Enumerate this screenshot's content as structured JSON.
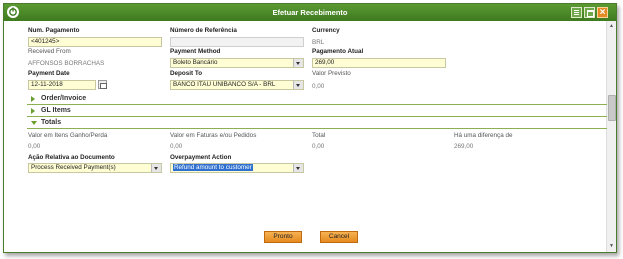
{
  "window": {
    "title": "Efetuar Recebimento",
    "accent": "#4a8a28",
    "icons": [
      "app-logo-icon",
      "menu-icon",
      "maximize-icon",
      "close-icon"
    ]
  },
  "form": {
    "num_pagamento_label": "Num. Pagamento",
    "num_pagamento_value": "<401245>",
    "numero_referencia_label": "Número de Referência",
    "numero_referencia_value": "",
    "currency_label": "Currency",
    "currency_value": "BRL",
    "received_from_label": "Received From",
    "received_from_value": "AFFONSOS BORRACHAS",
    "payment_method_label": "Payment Method",
    "payment_method_value": "Boleto Bancário",
    "pagamento_atual_label": "Pagamento Atual",
    "pagamento_atual_value": "269,00",
    "payment_date_label": "Payment Date",
    "payment_date_value": "12-11-2018",
    "deposit_to_label": "Deposit To",
    "deposit_to_value": "BANCO ITAU UNIBANCO S/A - BRL",
    "valor_previsto_label": "Valor Previsto",
    "valor_previsto_value": "0,00"
  },
  "sections": {
    "order_invoice": "Order/Invoice",
    "gl_items": "GL Items",
    "totals": "Totals"
  },
  "totals": {
    "itens_ganho_label": "Valor em Itens Ganho/Perda",
    "itens_ganho_value": "0,00",
    "faturas_pedidos_label": "Valor em Faturas e/ou Pedidos",
    "faturas_pedidos_value": "0,00",
    "total_label": "Total",
    "total_value": "0,00",
    "diferenca_label": "Há uma diferença de",
    "diferenca_value": "269,00",
    "acao_relativa_label": "Ação Relativa ao Documento",
    "acao_relativa_value": "Process Received Payment(s)",
    "overpayment_label": "Overpayment Action",
    "overpayment_value": "Refund amount to customer"
  },
  "buttons": {
    "pronto": "Pronto",
    "cancel": "Cancel"
  }
}
